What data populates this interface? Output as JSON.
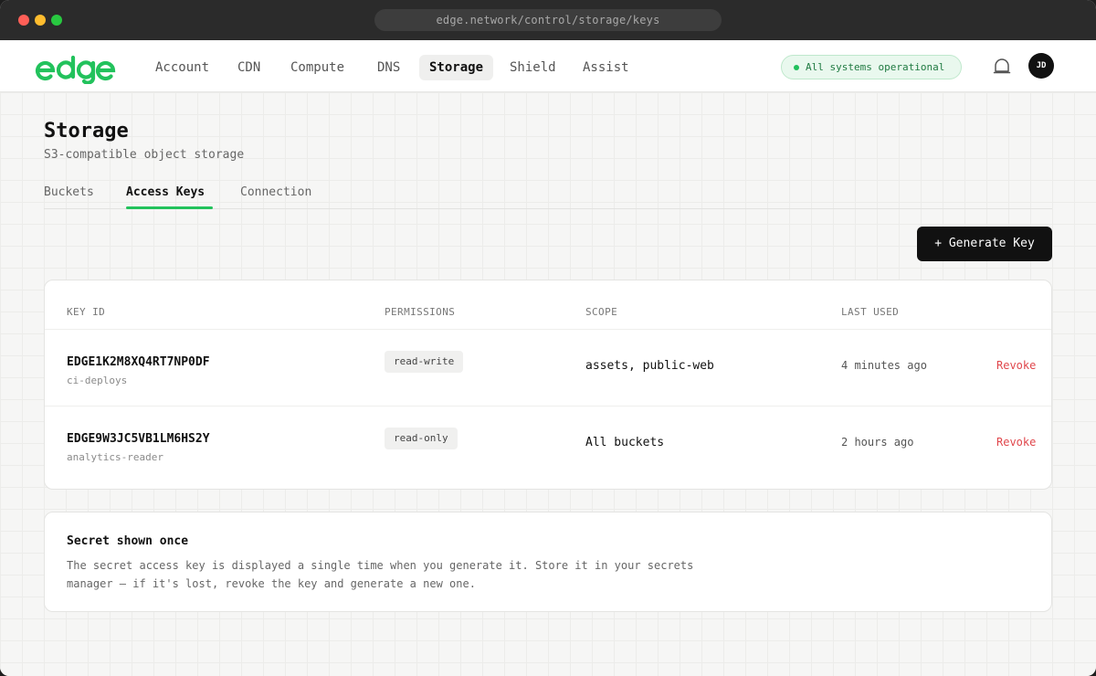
{
  "browser": {
    "url": "edge.network/control/storage/keys"
  },
  "brand": {
    "logo_text": "edge",
    "accent_color": "#22c25c"
  },
  "nav": {
    "items": [
      {
        "label": "Account"
      },
      {
        "label": "CDN"
      },
      {
        "label": "Compute"
      },
      {
        "label": "DNS"
      },
      {
        "label": "Storage",
        "active": true
      },
      {
        "label": "Shield"
      },
      {
        "label": "Assist"
      }
    ],
    "status": "All systems operational",
    "notifications_icon": "bell-icon",
    "avatar_initials": "JD"
  },
  "page": {
    "title": "Storage",
    "subtitle": "S3-compatible object storage"
  },
  "tabs": [
    {
      "label": "Buckets"
    },
    {
      "label": "Access Keys",
      "active": true
    },
    {
      "label": "Connection"
    }
  ],
  "actions": {
    "generate_label": "+ Generate Key"
  },
  "keys_table": {
    "columns": [
      "KEY ID",
      "PERMISSIONS",
      "SCOPE",
      "LAST USED"
    ],
    "rows": [
      {
        "key_id": "EDGE1K2M8XQ4RT7NP0DF",
        "name": "ci-deploys",
        "permissions": "read-write",
        "scope": "assets, public-web",
        "last_used": "4 minutes ago",
        "action": "Revoke"
      },
      {
        "key_id": "EDGE9W3JC5VB1LM6HS2Y",
        "name": "analytics-reader",
        "permissions": "read-only",
        "scope": "All buckets",
        "last_used": "2 hours ago",
        "action": "Revoke"
      }
    ]
  },
  "notice": {
    "title": "Secret shown once",
    "body": "The secret access key is displayed a single time when you generate it. Store it in your secrets manager — if it's lost, revoke the key and generate a new one."
  }
}
